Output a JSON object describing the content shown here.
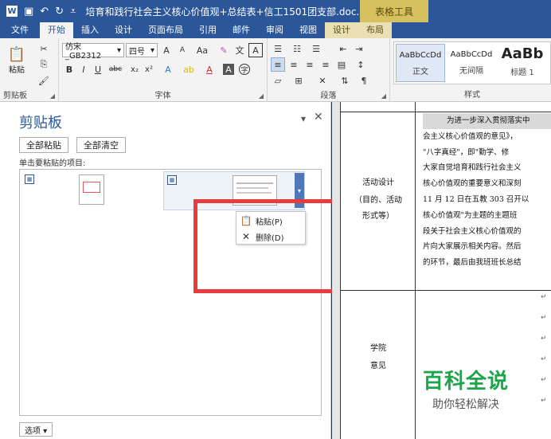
{
  "titlebar": {
    "title": "培育和践行社会主义核心价值观+总结表+信工1501团支部.doc...",
    "context_group": "表格工具"
  },
  "tabs": [
    {
      "label": "文件",
      "state": "file"
    },
    {
      "label": "开始",
      "state": "active"
    },
    {
      "label": "插入",
      "state": ""
    },
    {
      "label": "设计",
      "state": ""
    },
    {
      "label": "页面布局",
      "state": ""
    },
    {
      "label": "引用",
      "state": ""
    },
    {
      "label": "邮件",
      "state": ""
    },
    {
      "label": "审阅",
      "state": ""
    },
    {
      "label": "视图",
      "state": ""
    },
    {
      "label": "设计",
      "state": "ctx"
    },
    {
      "label": "布局",
      "state": "ctx"
    }
  ],
  "ribbon": {
    "clipboard": {
      "paste": "粘贴",
      "label": "剪贴板"
    },
    "font": {
      "family": "仿宋_GB2312",
      "size": "四号",
      "label": "字体",
      "aa": "Aa",
      "grow": "A",
      "shrink": "A"
    },
    "paragraph": {
      "label": "段落"
    },
    "styles": {
      "label": "样式",
      "items": [
        {
          "sample": "AaBbCcDd",
          "name": "正文"
        },
        {
          "sample": "AaBbCcDd",
          "name": "无间隔"
        },
        {
          "sample": "AaBb",
          "name": "标题 1"
        }
      ]
    }
  },
  "pane": {
    "title": "剪贴板",
    "paste_all": "全部粘贴",
    "clear_all": "全部清空",
    "hint": "单击要粘贴的项目:",
    "options": "选项 ▾",
    "menu": {
      "paste": "粘贴(P)",
      "delete": "删除(D)"
    }
  },
  "doc": {
    "label1_line1": "活动设计",
    "label1_line2": "（目的、活动",
    "label1_line3": "形式等）",
    "label2_line1": "学院",
    "label2_line2": "意见",
    "lines": [
      "为进一步深入贯彻落实中",
      "会主义核心价值观的意见》，",
      "\"八字真经\"，即\"勤学、修",
      "大家自觉培育和践行社会主义",
      "核心价值观的重要意义和深刻",
      "11 月 12 日在五教 303 召开以",
      "核心价值观\"为主题的主题班",
      "段关于社会主义核心价值观的",
      "片向大家展示相关内容。然后",
      "的环节，最后由我班班长总结"
    ]
  },
  "watermark": {
    "title": "百科全说",
    "subtitle": "助你轻松解决"
  }
}
